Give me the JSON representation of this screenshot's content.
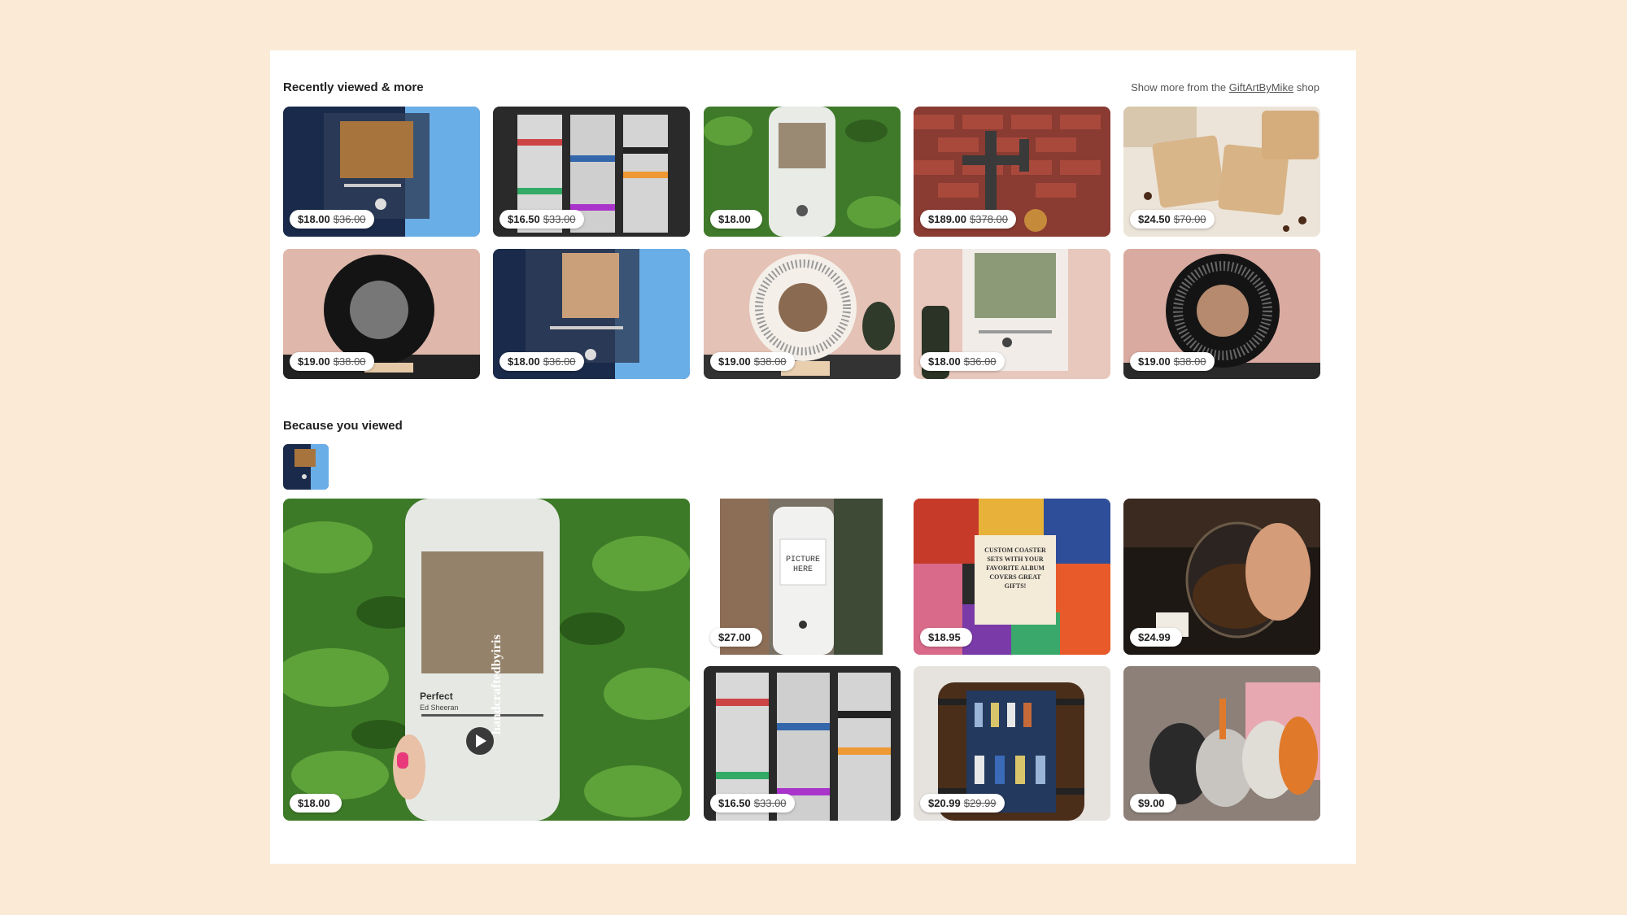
{
  "recently": {
    "title": "Recently viewed & more",
    "show_more_prefix": "Show more from the ",
    "show_more_shop": "GiftArtByMike",
    "show_more_suffix": " shop",
    "items": [
      {
        "price": "$18.00",
        "orig": "$36.00",
        "icon": "acrylic-song-plaque-image"
      },
      {
        "price": "$16.50",
        "orig": "$33.00",
        "icon": "cassette-tumbler-image"
      },
      {
        "price": "$18.00",
        "orig": "",
        "icon": "frosted-glass-cup-image"
      },
      {
        "price": "$189.00",
        "orig": "$378.00",
        "icon": "pipe-lamp-image"
      },
      {
        "price": "$24.50",
        "orig": "$70.00",
        "icon": "wood-coasters-image"
      },
      {
        "price": "$19.00",
        "orig": "$38.00",
        "icon": "vinyl-record-plaque-image"
      },
      {
        "price": "$18.00",
        "orig": "$36.00",
        "icon": "acrylic-song-plaque-image"
      },
      {
        "price": "$19.00",
        "orig": "$38.00",
        "icon": "round-lyrics-plaque-image"
      },
      {
        "price": "$18.00",
        "orig": "$36.00",
        "icon": "family-song-plaque-image"
      },
      {
        "price": "$19.00",
        "orig": "$38.00",
        "icon": "vinyl-record-plaque-image"
      }
    ]
  },
  "because": {
    "title": "Because you viewed",
    "featured": {
      "price": "$18.00",
      "orig": "",
      "song": "Perfect",
      "artist": "Ed Sheeran",
      "watermark": "handcraftedbyiris"
    },
    "items": [
      {
        "price": "$27.00",
        "orig": "",
        "label": "PICTURE HERE",
        "icon": "picture-cup-image"
      },
      {
        "price": "$18.95",
        "orig": "",
        "label": "CUSTOM COASTER SETS WITH YOUR FAVORITE ALBUM COVERS GREAT GIFTS!",
        "icon": "album-coasters-image"
      },
      {
        "price": "$24.99",
        "orig": "",
        "icon": "engraved-whiskey-glass-image"
      },
      {
        "price": "$16.50",
        "orig": "$33.00",
        "icon": "cassette-tumbler-image"
      },
      {
        "price": "$20.99",
        "orig": "$29.99",
        "icon": "barrel-bar-cabinet-image"
      },
      {
        "price": "$9.00",
        "orig": "",
        "icon": "felt-cat-ornaments-image"
      }
    ]
  },
  "colors": {
    "page_bg": "#fbebd6",
    "panel_bg": "#ffffff"
  }
}
